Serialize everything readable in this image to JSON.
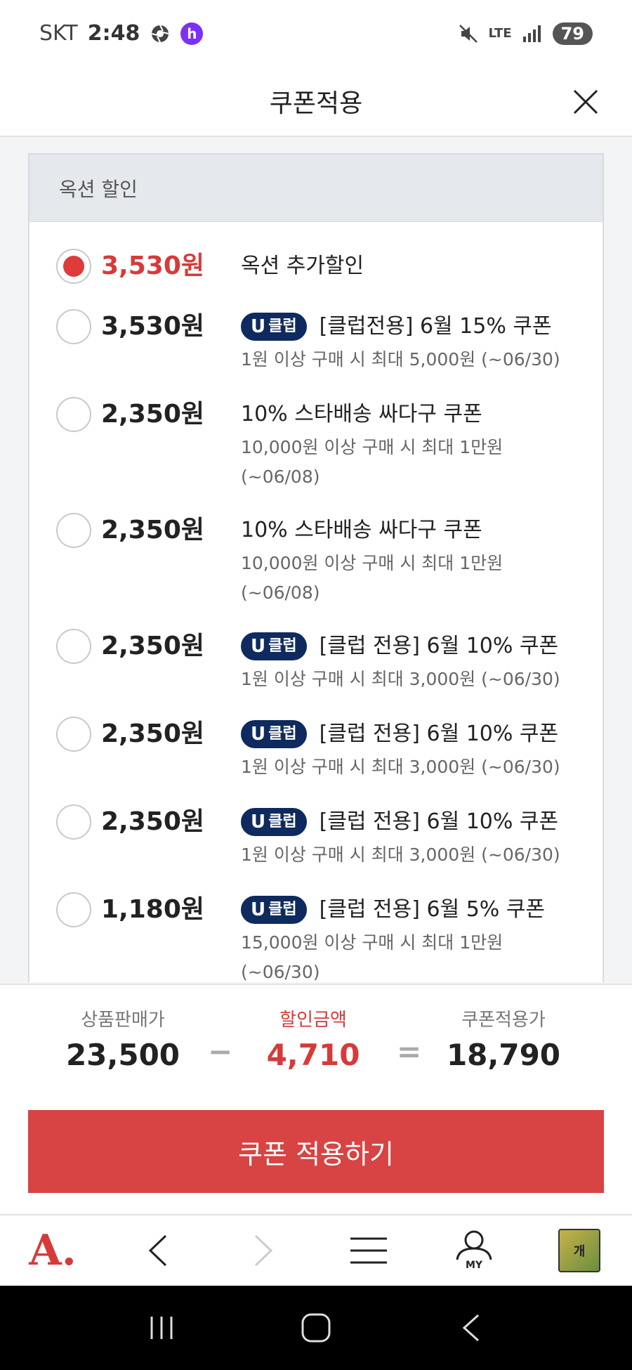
{
  "status_bar": {
    "carrier": "SKT",
    "time": "2:48",
    "network": "LTE",
    "battery": "79"
  },
  "header": {
    "title": "쿠폰적용"
  },
  "section": {
    "title": "옥션 할인"
  },
  "coupons": [
    {
      "amount": "3,530원",
      "title": "옥션 추가할인",
      "sub1": "",
      "sub2": "",
      "selected": true,
      "uclub": false
    },
    {
      "amount": "3,530원",
      "title": "[클럽전용] 6월 15% 쿠폰",
      "sub1": "1원 이상 구매 시 최대 5,000원 (~06/30)",
      "sub2": "",
      "selected": false,
      "uclub": true
    },
    {
      "amount": "2,350원",
      "title": "10% 스타배송 싸다구 쿠폰",
      "sub1": "10,000원 이상 구매 시 최대 1만원",
      "sub2": "(~06/08)",
      "selected": false,
      "uclub": false
    },
    {
      "amount": "2,350원",
      "title": "10% 스타배송 싸다구 쿠폰",
      "sub1": "10,000원 이상 구매 시 최대 1만원",
      "sub2": "(~06/08)",
      "selected": false,
      "uclub": false
    },
    {
      "amount": "2,350원",
      "title": "[클럽 전용] 6월 10% 쿠폰",
      "sub1": "1원 이상 구매 시 최대 3,000원 (~06/30)",
      "sub2": "",
      "selected": false,
      "uclub": true
    },
    {
      "amount": "2,350원",
      "title": "[클럽 전용] 6월 10% 쿠폰",
      "sub1": "1원 이상 구매 시 최대 3,000원 (~06/30)",
      "sub2": "",
      "selected": false,
      "uclub": true
    },
    {
      "amount": "2,350원",
      "title": "[클럽 전용] 6월 10% 쿠폰",
      "sub1": "1원 이상 구매 시 최대 3,000원 (~06/30)",
      "sub2": "",
      "selected": false,
      "uclub": true
    },
    {
      "amount": "1,180원",
      "title": "[클럽 전용] 6월 5% 쿠폰",
      "sub1": "15,000원 이상 구매 시 최대 1만원",
      "sub2": "(~06/30)",
      "selected": false,
      "uclub": true
    }
  ],
  "uclub_badge": {
    "u": "U",
    "text": "클럽"
  },
  "summary": {
    "price_label": "상품판매가",
    "price_value": "23,500",
    "minus": "−",
    "discount_label": "할인금액",
    "discount_value": "4,710",
    "equals": "=",
    "final_label": "쿠폰적용가",
    "final_value": "18,790"
  },
  "apply_button": "쿠폰 적용하기",
  "bottom_nav": {
    "logo": "A.",
    "my_label": "MY",
    "thumb_label": "개"
  },
  "colors": {
    "accent_red": "#d84343",
    "uclub_navy": "#0e2a5e",
    "section_bg": "#e5e8ec"
  }
}
